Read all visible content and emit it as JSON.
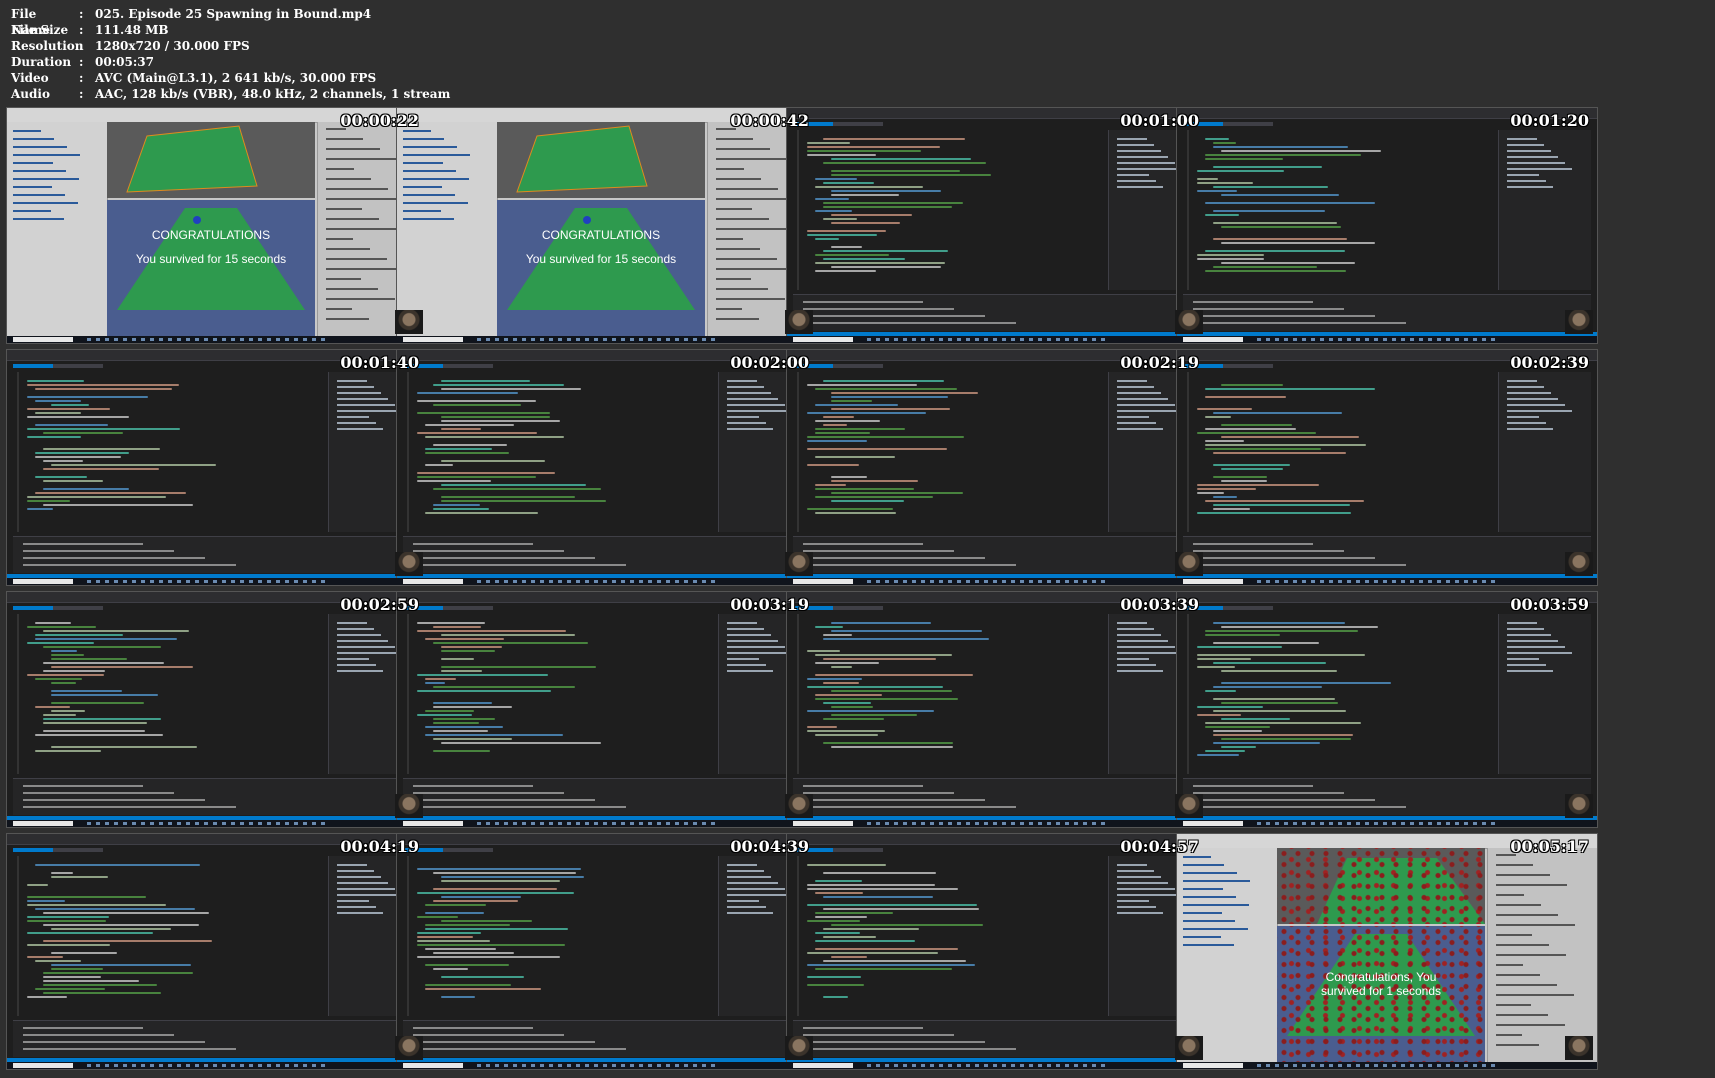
{
  "info": [
    {
      "label": "File Name",
      "value": "025. Episode 25   Spawning in Bound.mp4"
    },
    {
      "label": "File Size",
      "value": "111.48 MB"
    },
    {
      "label": "Resolution",
      "value": "1280x720 / 30.000 FPS"
    },
    {
      "label": "Duration",
      "value": "00:05:37"
    },
    {
      "label": "Video",
      "value": "AVC (Main@L3.1), 2 641 kb/s, 30.000 FPS"
    },
    {
      "label": "Audio",
      "value": "AAC, 128 kb/s (VBR), 48.0 kHz, 2 channels, 1 stream"
    }
  ],
  "separator": ":",
  "thumbnails": [
    {
      "timestamp": "00:00:22",
      "kind": "unity",
      "game_text": [
        "CONGRATULATIONS",
        "You survived for 15 seconds"
      ]
    },
    {
      "timestamp": "00:00:42",
      "kind": "unity",
      "game_text": [
        "CONGRATULATIONS",
        "You survived for 15 seconds"
      ]
    },
    {
      "timestamp": "00:01:00",
      "kind": "vs"
    },
    {
      "timestamp": "00:01:20",
      "kind": "vs"
    },
    {
      "timestamp": "00:01:40",
      "kind": "vs"
    },
    {
      "timestamp": "00:02:00",
      "kind": "vs"
    },
    {
      "timestamp": "00:02:19",
      "kind": "vs"
    },
    {
      "timestamp": "00:02:39",
      "kind": "vs"
    },
    {
      "timestamp": "00:02:59",
      "kind": "vs"
    },
    {
      "timestamp": "00:03:19",
      "kind": "vs"
    },
    {
      "timestamp": "00:03:39",
      "kind": "vs"
    },
    {
      "timestamp": "00:03:59",
      "kind": "vs"
    },
    {
      "timestamp": "00:04:19",
      "kind": "vs"
    },
    {
      "timestamp": "00:04:39",
      "kind": "vs"
    },
    {
      "timestamp": "00:04:57",
      "kind": "vs"
    },
    {
      "timestamp": "00:05:17",
      "kind": "unity-end",
      "game_text": [
        "Congratulations, You",
        "survived for 1 seconds"
      ]
    }
  ],
  "colors": {
    "background": "#2f2f2f",
    "vs_editor": "#1e1e1e",
    "vs_accent": "#007acc",
    "unity_game_bg": "#4a5d8f",
    "ground_green": "#2e9a4e",
    "block_red": "#8b1d1d"
  }
}
